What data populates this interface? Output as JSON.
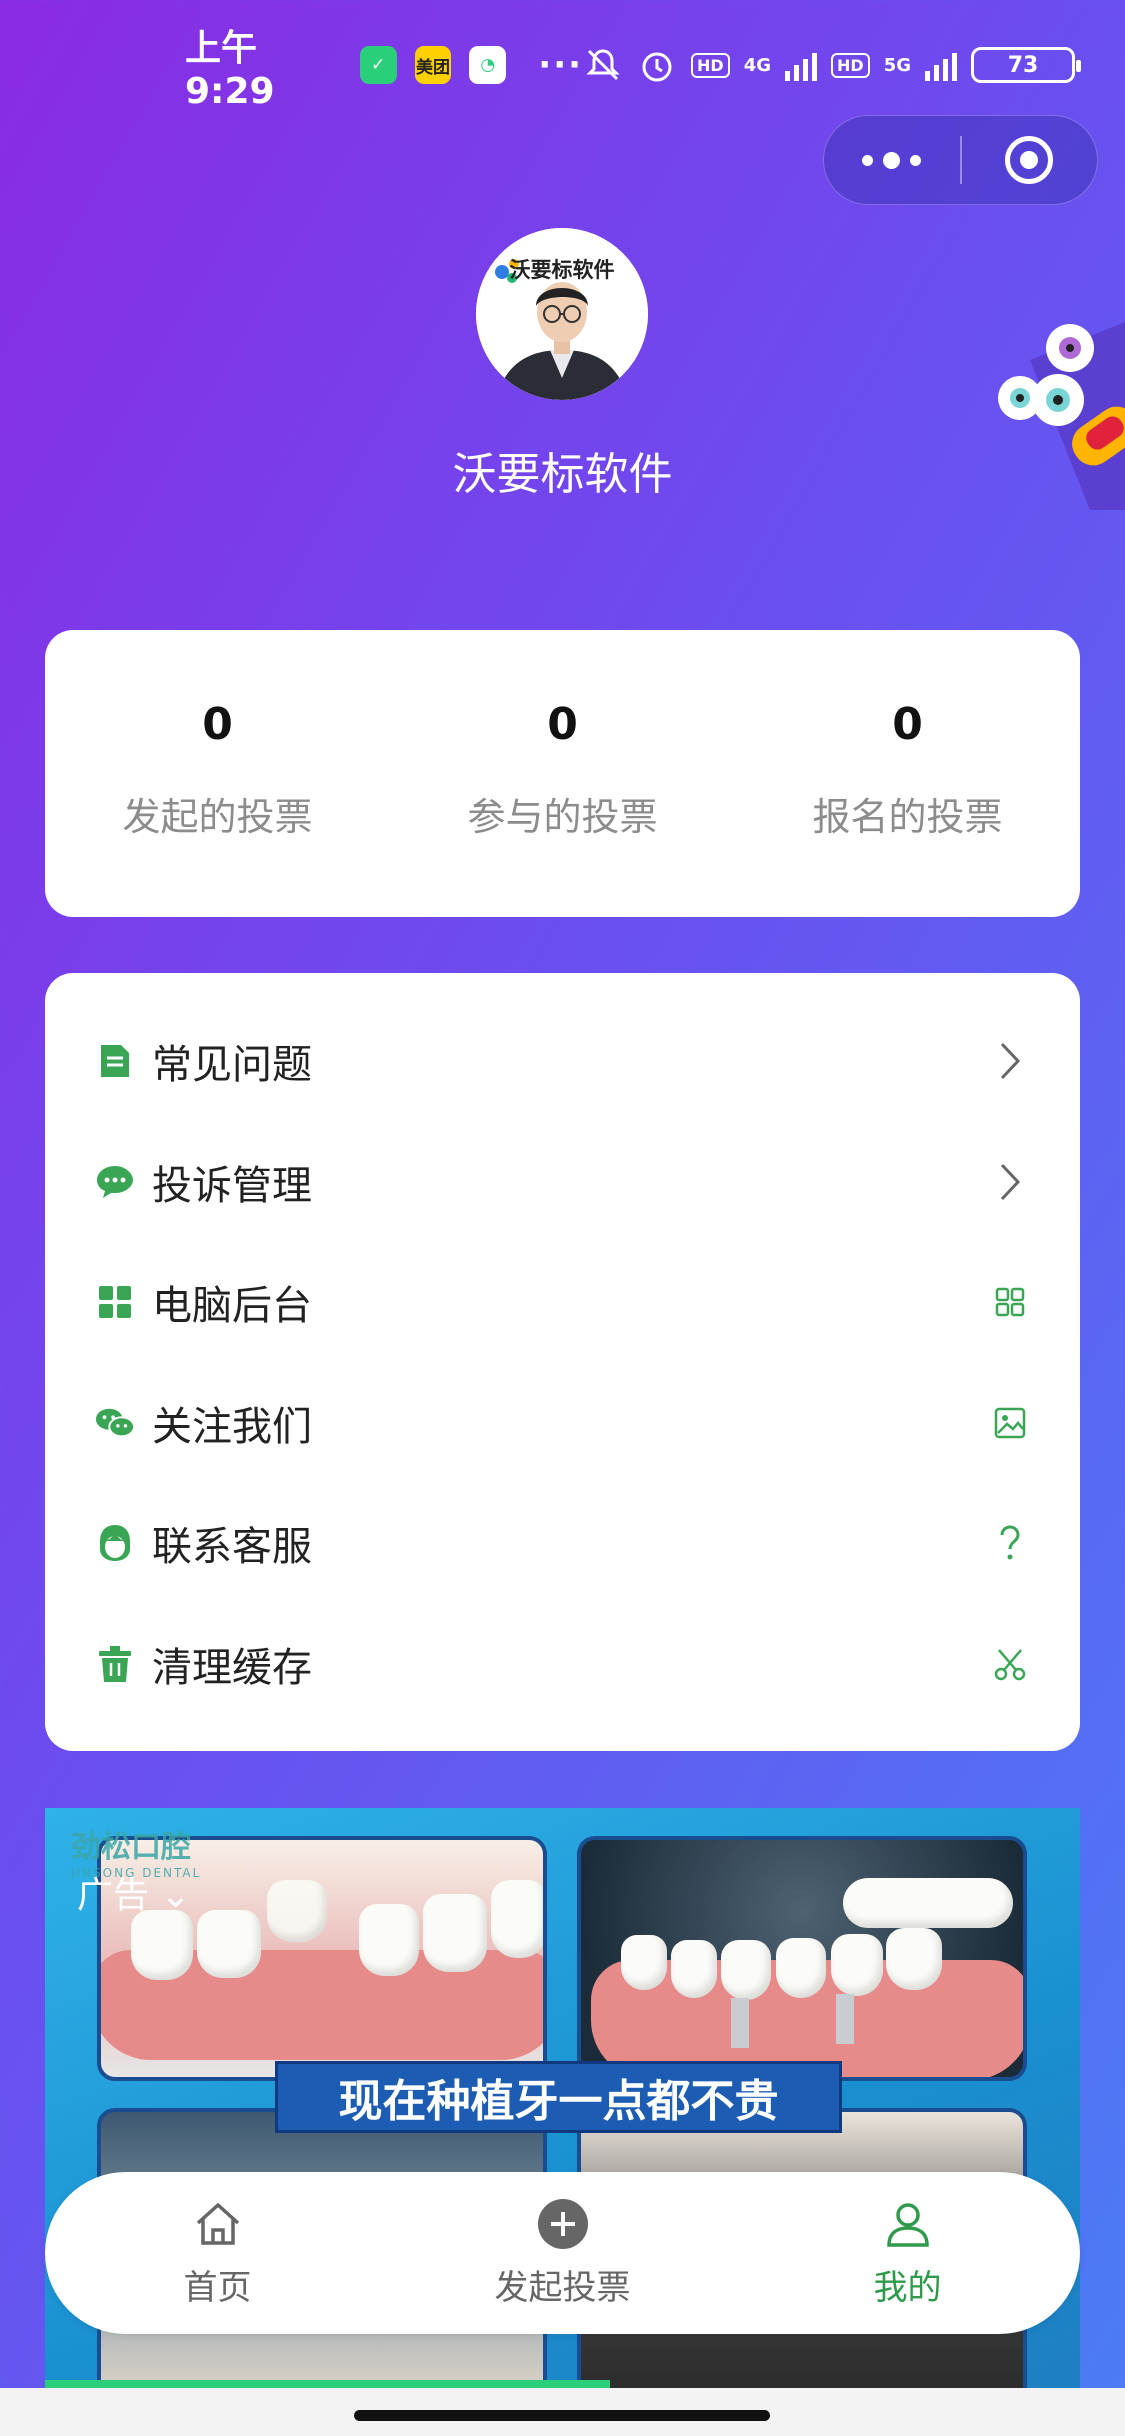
{
  "status_bar": {
    "time": "上午9:29",
    "app_badge_meituan": "美团",
    "more": "···",
    "hd_1": "HD",
    "net_1": "4G",
    "hd_2": "HD",
    "net_2": "5G",
    "battery": "73"
  },
  "profile": {
    "avatar_logo_text": "沃要标软件",
    "name": "沃要标软件"
  },
  "stats": [
    {
      "value": "0",
      "label": "发起的投票"
    },
    {
      "value": "0",
      "label": "参与的投票"
    },
    {
      "value": "0",
      "label": "报名的投票"
    }
  ],
  "menu": [
    {
      "label": "常见问题",
      "icon": "document-icon",
      "right_icon": "chevron-right-icon"
    },
    {
      "label": "投诉管理",
      "icon": "chat-bubble-icon",
      "right_icon": "chevron-right-icon"
    },
    {
      "label": "电脑后台",
      "icon": "grid-icon",
      "right_icon": "grid-outline-icon"
    },
    {
      "label": "关注我们",
      "icon": "wechat-icon",
      "right_icon": "image-icon"
    },
    {
      "label": "联系客服",
      "icon": "customer-service-icon",
      "right_icon": "question-icon"
    },
    {
      "label": "清理缓存",
      "icon": "trash-icon",
      "right_icon": "scissors-icon"
    }
  ],
  "ad": {
    "brand": "劲松口腔",
    "brand_en": "JINSONG DENTAL",
    "tag": "广告 ⌄",
    "headline": "现在种植牙一点都不贵"
  },
  "tabbar": [
    {
      "label": "首页",
      "icon": "home-icon",
      "active": false
    },
    {
      "label": "发起投票",
      "icon": "plus-circle-icon",
      "active": false
    },
    {
      "label": "我的",
      "icon": "user-icon",
      "active": true
    }
  ],
  "colors": {
    "accent_green": "#2e9a4a",
    "gradient_start": "#8a2be2",
    "gradient_end": "#4b7cf5"
  }
}
